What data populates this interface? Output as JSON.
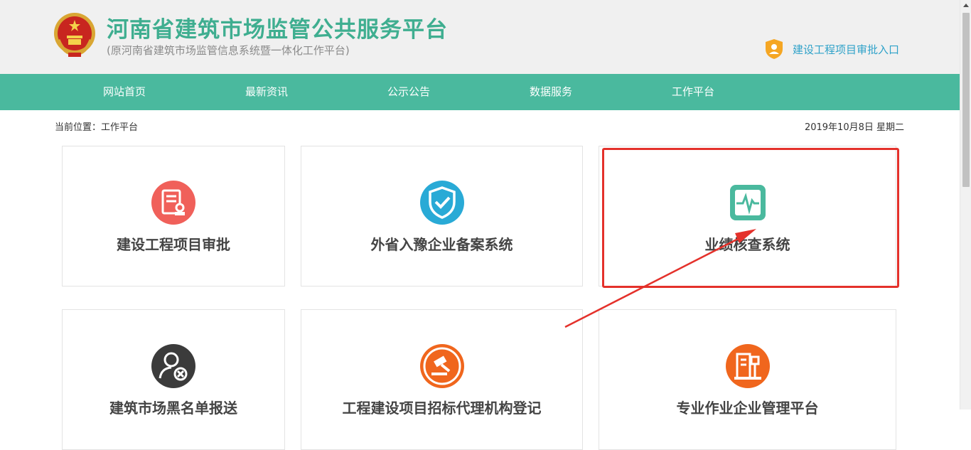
{
  "header": {
    "title": "河南省建筑市场监管公共服务平台",
    "subtitle": "(原河南省建筑市场监管信息系统暨一体化工作平台)",
    "approval_link": "建设工程项目审批入口"
  },
  "nav": {
    "items": [
      "网站首页",
      "最新资讯",
      "公示公告",
      "数据服务",
      "工作平台"
    ]
  },
  "breadcrumb": "当前位置：工作平台",
  "date": "2019年10月8日 星期二",
  "cards": [
    {
      "label": "建设工程项目审批",
      "icon": "approval-document-icon",
      "color": "#f0605a"
    },
    {
      "label": "外省入豫企业备案系统",
      "icon": "shield-check-icon",
      "color": "#29aad6"
    },
    {
      "label": "业绩核查系统",
      "icon": "monitor-pulse-icon",
      "color": "#4ab99e"
    },
    {
      "label": "建筑市场黑名单报送",
      "icon": "user-blocked-icon",
      "color": "#3b3b3b"
    },
    {
      "label": "工程建设项目招标代理机构登记",
      "icon": "gavel-icon",
      "color": "#f0661d"
    },
    {
      "label": "专业作业企业管理平台",
      "icon": "building-crane-icon",
      "color": "#f0661d"
    }
  ],
  "colors": {
    "brand_green": "#4ab99e",
    "annotation_red": "#e4312b",
    "link_blue": "#2fa2c9"
  }
}
